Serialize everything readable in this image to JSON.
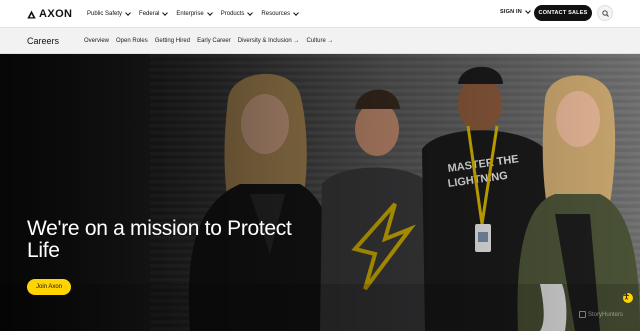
{
  "brand": {
    "name": "AXON",
    "logo_icon": "axon-delta-logo",
    "accent": "#ffd400",
    "dark": "#111111"
  },
  "topnav": {
    "menu": [
      {
        "label": "Public Safety"
      },
      {
        "label": "Federal"
      },
      {
        "label": "Enterprise"
      },
      {
        "label": "Products"
      },
      {
        "label": "Resources"
      }
    ],
    "sign_in": "SIGN IN",
    "cta": "CONTACT SALES",
    "search_icon": "search-icon"
  },
  "subnav": {
    "title": "Careers",
    "links": [
      {
        "label": "Overview"
      },
      {
        "label": "Open Roles"
      },
      {
        "label": "Getting Hired"
      },
      {
        "label": "Early Career"
      },
      {
        "label": "Diversity & Inclusion →"
      },
      {
        "label": "Culture →"
      }
    ]
  },
  "hero": {
    "heading": "We're on a mission to Protect Life",
    "button": "Join Axon",
    "shirt_text": "MASTER THE LIGHTNING",
    "watermark": "StoryHunters",
    "accessibility_icon": "accessibility-icon"
  }
}
